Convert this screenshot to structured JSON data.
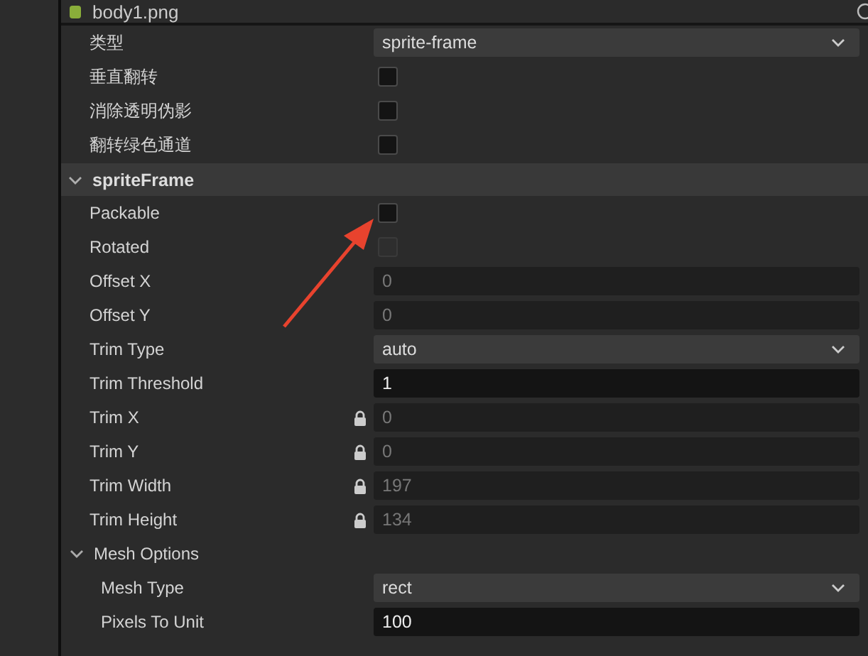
{
  "asset": {
    "title": "body1.png"
  },
  "properties": [
    {
      "kind": "select",
      "label": "类型",
      "value": "sprite-frame"
    },
    {
      "kind": "checkbox",
      "label": "垂直翻转",
      "checked": false,
      "disabled": false
    },
    {
      "kind": "checkbox",
      "label": "消除透明伪影",
      "checked": false,
      "disabled": false
    },
    {
      "kind": "checkbox",
      "label": "翻转绿色通道",
      "checked": false,
      "disabled": false
    }
  ],
  "section": {
    "title": "spriteFrame",
    "expanded": true,
    "properties": [
      {
        "kind": "checkbox",
        "label": "Packable",
        "checked": false,
        "disabled": false
      },
      {
        "kind": "checkbox",
        "label": "Rotated",
        "checked": false,
        "disabled": true
      },
      {
        "kind": "number",
        "label": "Offset X",
        "value": "0",
        "disabled": true,
        "locked": false
      },
      {
        "kind": "number",
        "label": "Offset Y",
        "value": "0",
        "disabled": true,
        "locked": false
      },
      {
        "kind": "select",
        "label": "Trim Type",
        "value": "auto"
      },
      {
        "kind": "number",
        "label": "Trim Threshold",
        "value": "1",
        "disabled": false,
        "locked": false
      },
      {
        "kind": "number",
        "label": "Trim X",
        "value": "0",
        "disabled": true,
        "locked": true
      },
      {
        "kind": "number",
        "label": "Trim Y",
        "value": "0",
        "disabled": true,
        "locked": true
      },
      {
        "kind": "number",
        "label": "Trim Width",
        "value": "197",
        "disabled": true,
        "locked": true
      },
      {
        "kind": "number",
        "label": "Trim Height",
        "value": "134",
        "disabled": true,
        "locked": true
      }
    ],
    "group": {
      "title": "Mesh Options",
      "expanded": true,
      "properties": [
        {
          "kind": "select",
          "label": "Mesh Type",
          "value": "rect"
        },
        {
          "kind": "number",
          "label": "Pixels To Unit",
          "value": "100",
          "disabled": false,
          "locked": false
        }
      ]
    }
  }
}
